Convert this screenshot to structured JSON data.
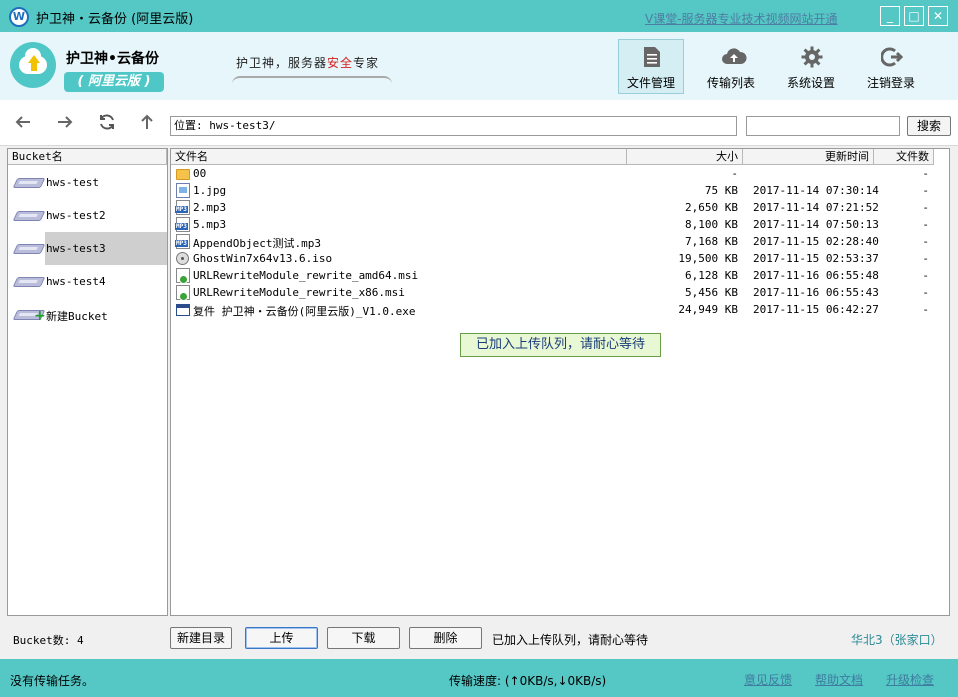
{
  "window": {
    "title": "护卫神・云备份 (阿里云版)",
    "ad_link": "V课堂-服务器专业技术视频网站开通",
    "controls": {
      "minimize": "_",
      "maximize": "□",
      "close": "✕"
    }
  },
  "brand": {
    "name": "护卫神•云备份",
    "edition": "( 阿里云版 )",
    "slogan_prefix": "护卫神，服务器",
    "slogan_highlight": "安全",
    "slogan_suffix": "专家"
  },
  "nav": [
    {
      "label": "文件管理",
      "icon": "document-icon",
      "active": true
    },
    {
      "label": "传输列表",
      "icon": "cloud-upload-icon",
      "active": false
    },
    {
      "label": "系统设置",
      "icon": "gear-icon",
      "active": false
    },
    {
      "label": "注销登录",
      "icon": "logout-icon",
      "active": false
    }
  ],
  "toolbar": {
    "back_icon": "arrow-left-icon",
    "forward_icon": "arrow-right-icon",
    "refresh_icon": "refresh-icon",
    "up_icon": "arrow-up-icon",
    "path_value": "位置: hws-test3/",
    "search_placeholder": "",
    "search_label": "搜索"
  },
  "buckets": {
    "header": "Bucket名",
    "items": [
      {
        "label": "hws-test",
        "selected": false
      },
      {
        "label": "hws-test2",
        "selected": false
      },
      {
        "label": "hws-test3",
        "selected": true
      },
      {
        "label": "hws-test4",
        "selected": false
      },
      {
        "label": "新建Bucket",
        "selected": false,
        "add": true
      }
    ]
  },
  "files": {
    "columns": {
      "name": "文件名",
      "size": "大小",
      "time": "更新时间",
      "count": "文件数"
    },
    "rows": [
      {
        "name": "00",
        "type": "folder",
        "size": "-",
        "time": "",
        "count": "-"
      },
      {
        "name": "1.jpg",
        "type": "image",
        "size": "75 KB",
        "time": "2017-11-14 07:30:14",
        "count": "-"
      },
      {
        "name": "2.mp3",
        "type": "mp3",
        "size": "2,650 KB",
        "time": "2017-11-14 07:21:52",
        "count": "-"
      },
      {
        "name": "5.mp3",
        "type": "mp3",
        "size": "8,100 KB",
        "time": "2017-11-14 07:50:13",
        "count": "-"
      },
      {
        "name": "AppendObject测试.mp3",
        "type": "mp3",
        "size": "7,168 KB",
        "time": "2017-11-15 02:28:40",
        "count": "-"
      },
      {
        "name": "GhostWin7x64v13.6.iso",
        "type": "iso",
        "size": "19,500 KB",
        "time": "2017-11-15 02:53:37",
        "count": "-"
      },
      {
        "name": "URLRewriteModule_rewrite_amd64.msi",
        "type": "msi",
        "size": "6,128 KB",
        "time": "2017-11-16 06:55:48",
        "count": "-"
      },
      {
        "name": "URLRewriteModule_rewrite_x86.msi",
        "type": "msi",
        "size": "5,456 KB",
        "time": "2017-11-16 06:55:43",
        "count": "-"
      },
      {
        "name": "复件 护卫神・云备份(阿里云版)_V1.0.exe",
        "type": "exe",
        "size": "24,949 KB",
        "time": "2017-11-15 06:42:27",
        "count": "-"
      }
    ]
  },
  "toast": "已加入上传队列，请耐心等待",
  "actions": {
    "bucket_count": "Bucket数: 4",
    "new_dir": "新建目录",
    "upload": "上传",
    "download": "下载",
    "delete": "删除",
    "status": "已加入上传队列，请耐心等待",
    "region": "华北3（张家口）"
  },
  "statusbar": {
    "text": "没有传输任务。",
    "speed": "传输速度: (↑0KB/s,↓0KB/s)",
    "feedback": "意见反馈",
    "help": "帮助文档",
    "upgrade": "升级检查"
  },
  "colors": {
    "accent": "#55c7c4",
    "header_bg": "#e6f6fa",
    "selection": "#cfcfcf",
    "toast_bg": "#e8f7d4"
  }
}
